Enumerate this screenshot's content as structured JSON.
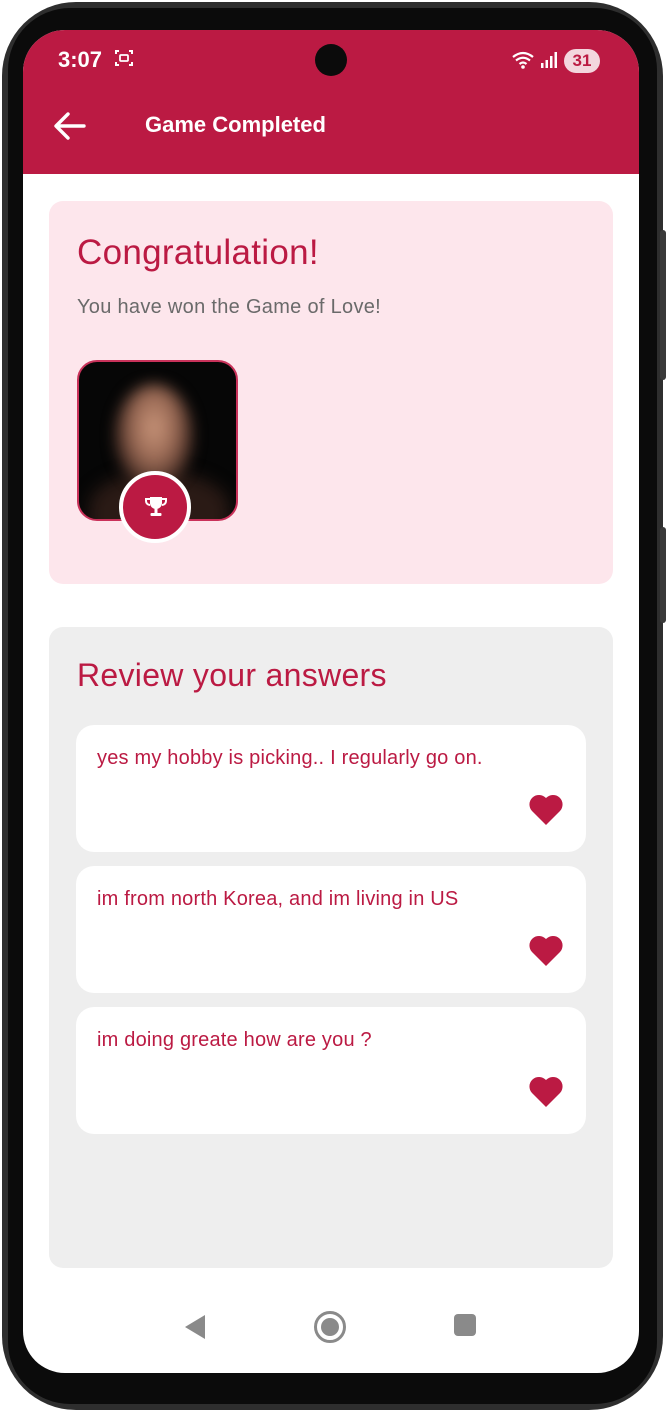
{
  "status": {
    "time": "3:07",
    "battery": "31"
  },
  "header": {
    "title": "Game Completed"
  },
  "result": {
    "heading": "Congratulation!",
    "message": "You have won the Game of Love!"
  },
  "review": {
    "title": "Review your answers",
    "answers": [
      {
        "text": "yes my hobby is picking.. I regularly go on."
      },
      {
        "text": "im from north Korea, and im living in US"
      },
      {
        "text": "im doing greate how are you ?"
      }
    ]
  },
  "colors": {
    "accent": "#bb1a43",
    "card_pink": "#fde6ec",
    "card_gray": "#eeeeee"
  },
  "icons": [
    "back-arrow-icon",
    "trophy-icon",
    "heart-icon",
    "nav-back-icon",
    "nav-home-icon",
    "nav-recent-icon"
  ]
}
